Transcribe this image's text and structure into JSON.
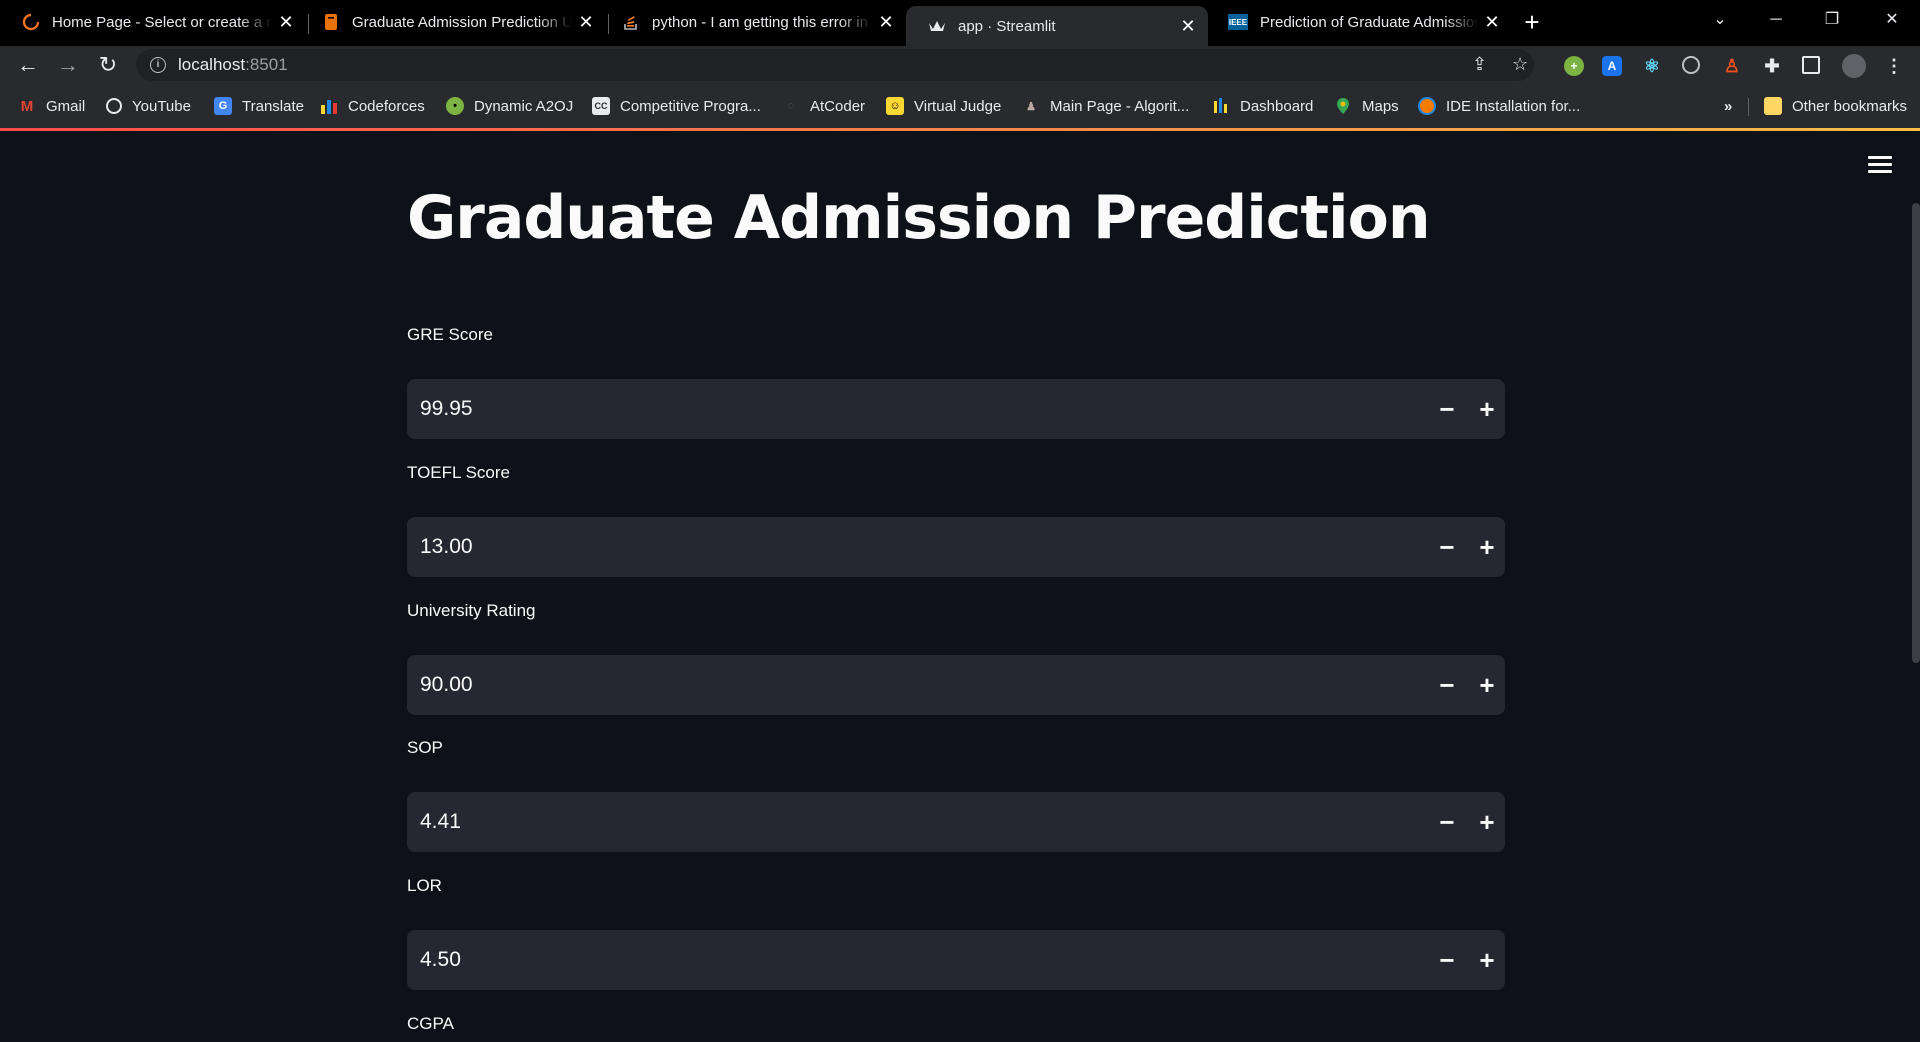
{
  "browser": {
    "tabs": [
      {
        "title": "Home Page - Select or create a n",
        "icon": "spinner-icon"
      },
      {
        "title": "Graduate Admission Prediction U",
        "icon": "book-icon"
      },
      {
        "title": "python - I am getting this error in",
        "icon": "stackoverflow-icon"
      },
      {
        "title": "app · Streamlit",
        "icon": "streamlit-crown-icon",
        "active": true
      },
      {
        "title": "Prediction of Graduate Admission",
        "icon": "ieee-icon"
      }
    ],
    "url_host": "localhost",
    "url_port": ":8501",
    "bookmarks": [
      {
        "label": "Gmail"
      },
      {
        "label": "YouTube"
      },
      {
        "label": "Translate"
      },
      {
        "label": "Codeforces"
      },
      {
        "label": "Dynamic A2OJ"
      },
      {
        "label": "Competitive Progra..."
      },
      {
        "label": "AtCoder"
      },
      {
        "label": "Virtual Judge"
      },
      {
        "label": "Main Page - Algorit..."
      },
      {
        "label": "Dashboard"
      },
      {
        "label": "Maps"
      },
      {
        "label": "IDE Installation for..."
      }
    ],
    "overflow_chevron": "»",
    "other_bookmarks": "Other bookmarks"
  },
  "app": {
    "title": "Graduate Admission Prediction",
    "fields": [
      {
        "label": "GRE Score",
        "value": "99.95"
      },
      {
        "label": "TOEFL Score",
        "value": "13.00"
      },
      {
        "label": "University Rating",
        "value": "90.00"
      },
      {
        "label": "SOP",
        "value": "4.41"
      },
      {
        "label": "LOR",
        "value": "4.50"
      },
      {
        "label": "CGPA"
      }
    ],
    "colors": {
      "background": "#0e1117",
      "input": "#262730",
      "text": "#fafafa",
      "accent": "#ff4b4b"
    }
  }
}
